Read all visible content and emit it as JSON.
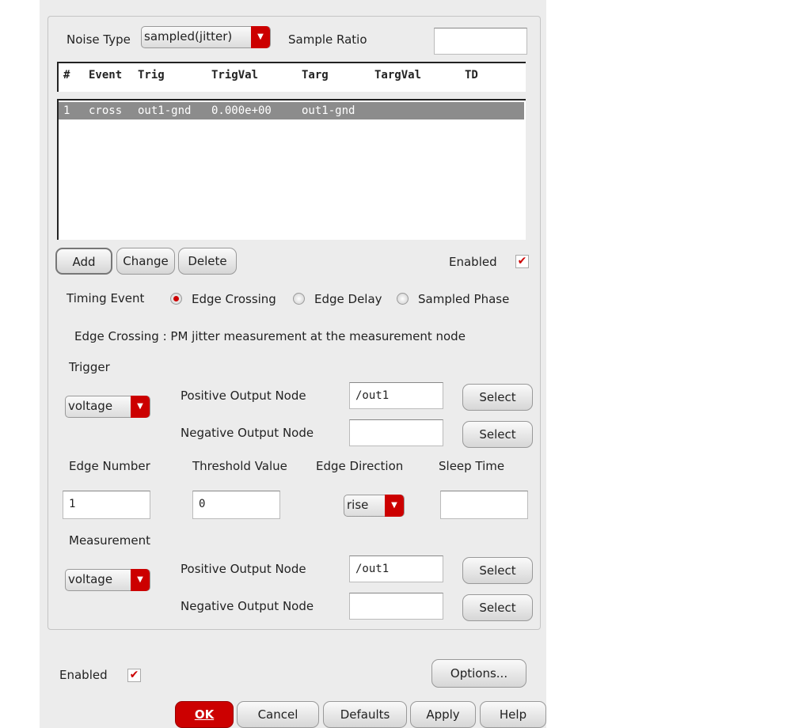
{
  "noise_type": {
    "label": "Noise Type",
    "value": "sampled(jitter)"
  },
  "sample_ratio": {
    "label": "Sample Ratio",
    "value": ""
  },
  "table": {
    "headers": [
      "#",
      "Event",
      "Trig",
      "TrigVal",
      "Targ",
      "TargVal",
      "TD"
    ],
    "rows": [
      {
        "num": "1",
        "event": "cross",
        "trig": "out1-gnd",
        "trigval": "0.000e+00",
        "targ": "out1-gnd",
        "targval": "",
        "td": ""
      }
    ]
  },
  "buttons": {
    "add": "Add",
    "change": "Change",
    "delete": "Delete",
    "select": "Select",
    "options": "Options...",
    "ok": "OK",
    "cancel": "Cancel",
    "defaults": "Defaults",
    "apply": "Apply",
    "help": "Help"
  },
  "enabled_label": "Enabled",
  "timing_event": {
    "label": "Timing Event",
    "options": [
      "Edge Crossing",
      "Edge Delay",
      "Sampled Phase"
    ],
    "selected": "Edge Crossing"
  },
  "description": "Edge Crossing : PM jitter measurement at the measurement node",
  "trigger": {
    "label": "Trigger",
    "type": "voltage",
    "pos_label": "Positive Output Node",
    "pos_value": "/out1",
    "neg_label": "Negative Output Node",
    "neg_value": ""
  },
  "edge_number": {
    "label": "Edge Number",
    "value": "1"
  },
  "threshold": {
    "label": "Threshold Value",
    "value": "0"
  },
  "edge_direction": {
    "label": "Edge Direction",
    "value": "rise"
  },
  "sleep_time": {
    "label": "Sleep Time",
    "value": ""
  },
  "measurement": {
    "label": "Measurement",
    "type": "voltage",
    "pos_label": "Positive Output Node",
    "pos_value": "/out1",
    "neg_label": "Negative Output Node",
    "neg_value": ""
  }
}
